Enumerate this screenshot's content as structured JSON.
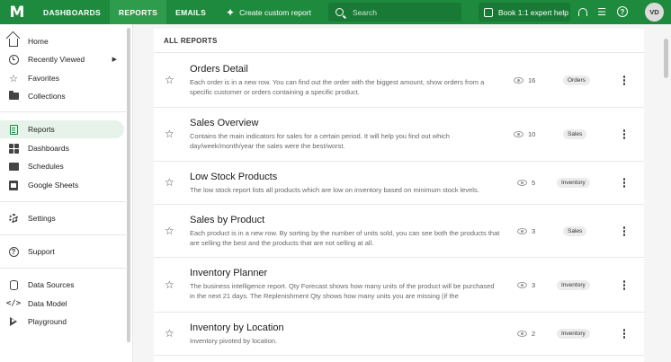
{
  "topbar": {
    "logo": "M",
    "tabs": [
      {
        "label": "DASHBOARDS"
      },
      {
        "label": "REPORTS"
      },
      {
        "label": "EMAILS"
      }
    ],
    "custom_report": "Create custom report",
    "search_placeholder": "Search",
    "expert_help": "Book 1:1 expert help",
    "avatar_initials": "VD",
    "brand_color": "#1e8a3e"
  },
  "sidebar": {
    "items": [
      {
        "label": "Home",
        "icon": "home-icon"
      },
      {
        "label": "Recently Viewed",
        "icon": "clock-icon"
      },
      {
        "label": "Favorites",
        "icon": "star-icon"
      },
      {
        "label": "Collections",
        "icon": "folder-icon"
      },
      {
        "label": "Reports",
        "icon": "report-icon"
      },
      {
        "label": "Dashboards",
        "icon": "dashboard-icon"
      },
      {
        "label": "Schedules",
        "icon": "schedule-icon"
      },
      {
        "label": "Google Sheets",
        "icon": "sheets-icon"
      },
      {
        "label": "Settings",
        "icon": "gear-icon"
      },
      {
        "label": "Support",
        "icon": "support-icon"
      },
      {
        "label": "Data Sources",
        "icon": "database-icon"
      },
      {
        "label": "Data Model",
        "icon": "code-icon"
      },
      {
        "label": "Playground",
        "icon": "play-icon"
      }
    ]
  },
  "main": {
    "header": "ALL REPORTS",
    "reports": [
      {
        "title": "Orders Detail",
        "desc": "Each order is in a new row. You can find out the order with the biggest amount, show orders from a specific customer or orders containing a specific product.",
        "views": "16",
        "tag": "Orders"
      },
      {
        "title": "Sales Overview",
        "desc": "Contains the main indicators for sales for a certain period. It will help you find out which day/week/month/year the sales were the best/worst.",
        "views": "10",
        "tag": "Sales"
      },
      {
        "title": "Low Stock Products",
        "desc": "The low stock report lists all products which are low on inventory based on minimum stock levels.",
        "views": "5",
        "tag": "Inventory"
      },
      {
        "title": "Sales by Product",
        "desc": "Each product is in a new row. By sorting by the number of units sold, you can see both the products that are selling the best and the products that are not selling at all.",
        "views": "3",
        "tag": "Sales"
      },
      {
        "title": "Inventory Planner",
        "desc": "The business intelligence report. Qty Forecast shows how many units of the product will be purchased in the next 21 days. The Replenishment Qty shows how many units you are missing (if the",
        "views": "3",
        "tag": "Inventory"
      },
      {
        "title": "Inventory by Location",
        "desc": "Inventory pivoted by location.",
        "views": "2",
        "tag": "Inventory"
      }
    ]
  }
}
